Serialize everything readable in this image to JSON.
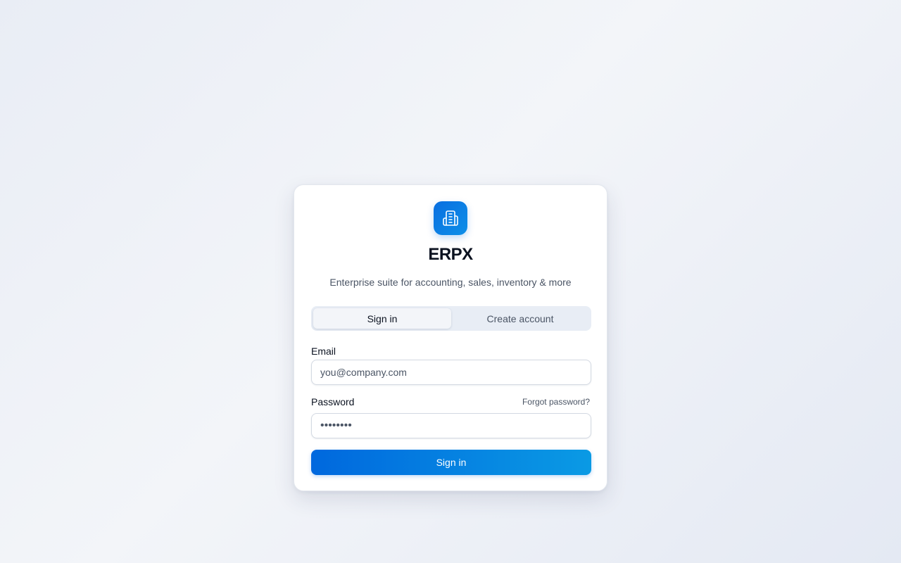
{
  "app": {
    "logo_icon": "building-icon",
    "title": "ERPX",
    "subtitle": "Enterprise suite for accounting, sales, inventory & more"
  },
  "tabs": [
    {
      "label": "Sign in",
      "active": true
    },
    {
      "label": "Create account",
      "active": false
    }
  ],
  "form": {
    "email_label": "Email",
    "email_placeholder": "you@company.com",
    "email_value": "",
    "password_label": "Password",
    "forgot_label": "Forgot password?",
    "password_value": "••••••••",
    "submit_label": "Sign in"
  },
  "colors": {
    "accent": "#0068de",
    "accent_end": "#0a9ae4",
    "background": "#eef1f6"
  }
}
